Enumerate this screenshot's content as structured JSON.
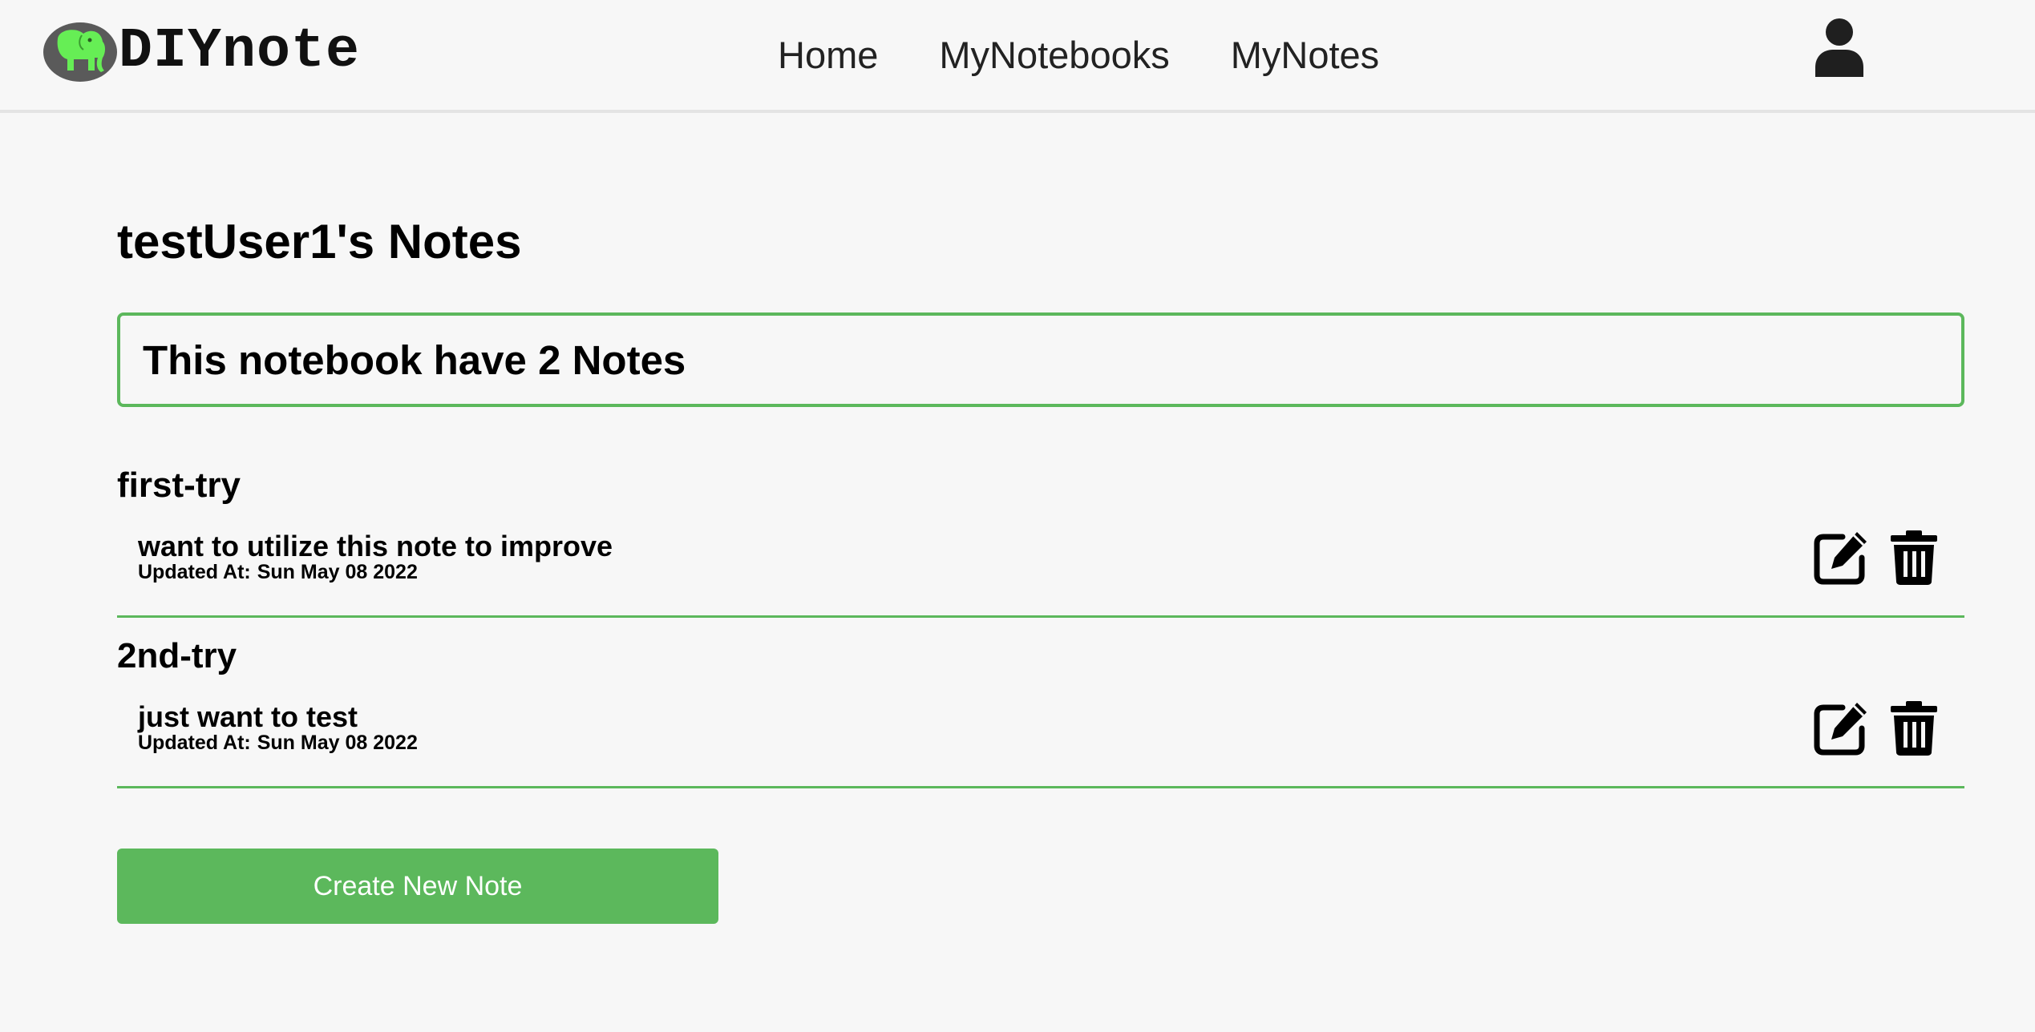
{
  "nav": {
    "brand": "DIYnote",
    "links": [
      {
        "label": "Home"
      },
      {
        "label": "MyNotebooks"
      },
      {
        "label": "MyNotes"
      }
    ],
    "icons": {
      "logo": "elephant-logo-icon",
      "user": "user-icon"
    }
  },
  "main": {
    "title": "testUser1's Notes",
    "count_text": "This notebook have 2 Notes",
    "notes": [
      {
        "title": "first-try",
        "content": "want to utilize this note to improve",
        "updated_label": "Updated At:",
        "updated_value": "Sun May 08 2022"
      },
      {
        "title": "2nd-try",
        "content": "just want to test",
        "updated_label": "Updated At:",
        "updated_value": "Sun May 08 2022"
      }
    ],
    "note_action_icons": [
      "edit-icon",
      "trash-icon"
    ],
    "create_button": "Create New Note"
  },
  "colors": {
    "accent": "#5cb85c",
    "background": "#f7f7f7",
    "logo_green": "#66ee55",
    "logo_oval": "#5a5a5a"
  }
}
